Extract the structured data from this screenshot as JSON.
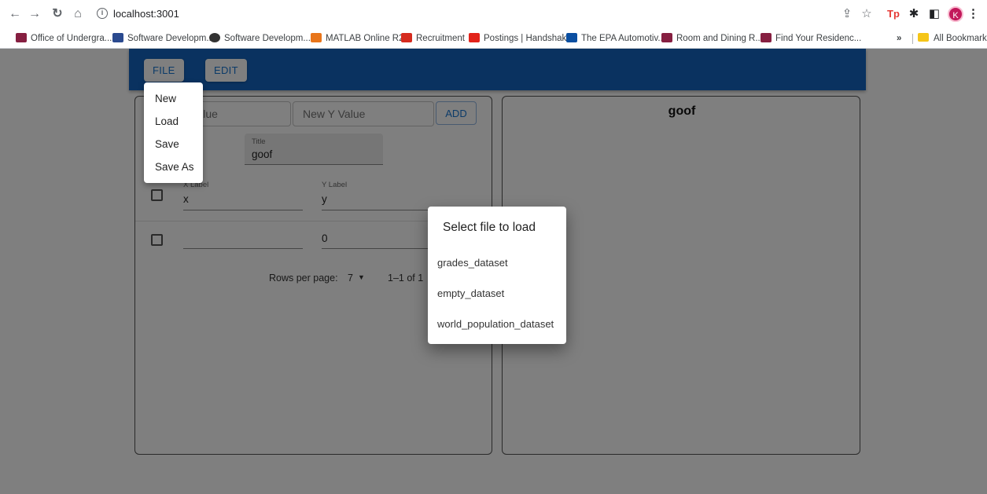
{
  "browser": {
    "url": "localhost:3001",
    "profile_initial": "K",
    "extension_label": "Tp"
  },
  "bookmarks": {
    "items": [
      {
        "label": "Office of Undergra...",
        "color": "#861f41"
      },
      {
        "label": "Software Developm...",
        "color": "#2b4a8f"
      },
      {
        "label": "Software Developm...",
        "color": "#333333"
      },
      {
        "label": "MATLAB Online R2...",
        "color": "#e8751a"
      },
      {
        "label": "Recruitment",
        "color": "#d52b1e"
      },
      {
        "label": "Postings | Handshake",
        "color": "#e2231a"
      },
      {
        "label": "The EPA Automotiv...",
        "color": "#0b4fa1"
      },
      {
        "label": "Room and Dining R...",
        "color": "#861f41"
      },
      {
        "label": "Find Your Residenc...",
        "color": "#861f41"
      }
    ],
    "overflow": "»",
    "all_bookmarks": "All Bookmarks"
  },
  "appbar": {
    "file_label": "FILE",
    "edit_label": "EDIT",
    "color": "#1565c0"
  },
  "editor": {
    "new_x_placeholder": "New X Value",
    "new_y_placeholder": "New Y Value",
    "add_label": "ADD",
    "title_label": "Title",
    "title_value": "goof",
    "x_label_label": "X Label",
    "x_label_value": "x",
    "y_label_label": "Y Label",
    "y_label_value": "y",
    "row_x_value": "",
    "row_y_value": "0",
    "rows_per_page_label": "Rows per page:",
    "rows_per_page_value": "7",
    "pagination_range": "1–1 of 1"
  },
  "chart": {
    "title": "goof"
  },
  "file_menu": {
    "items": [
      "New",
      "Load",
      "Save",
      "Save As"
    ]
  },
  "load_dialog": {
    "title": "Select file to load",
    "files": [
      "grades_dataset",
      "empty_dataset",
      "world_population_dataset"
    ]
  }
}
